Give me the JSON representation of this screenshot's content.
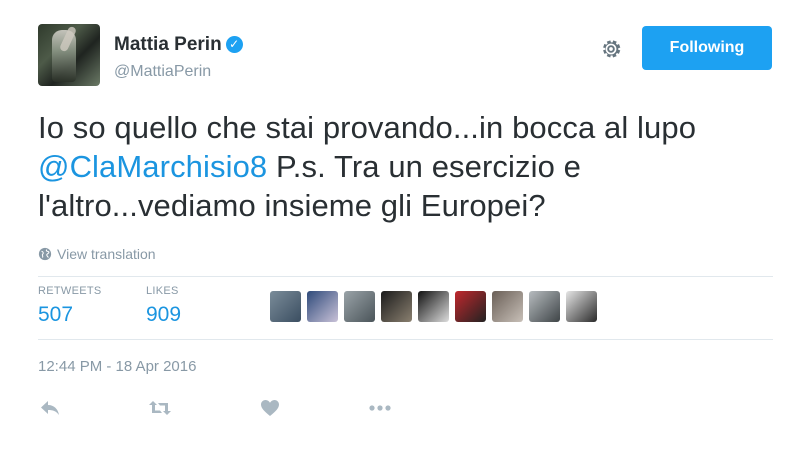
{
  "author": {
    "display_name": "Mattia Perin",
    "handle": "@MattiaPerin",
    "verified": true
  },
  "follow_button": {
    "label": "Following",
    "color": "#1da1f2"
  },
  "tweet": {
    "text_part1": "Io so quello che stai provando...in bocca al lupo ",
    "mention": "@ClaMarchisio8",
    "text_part2": " P.s. Tra un esercizio e l'altro...vediamo insieme gli Europei?",
    "mention_color": "#1b95e0"
  },
  "translation_link": "View translation",
  "stats": {
    "retweets_label": "RETWEETS",
    "retweets_value": "507",
    "likes_label": "LIKES",
    "likes_value": "909"
  },
  "liker_avatars": [
    {
      "name": "liker-avatar-1",
      "colors": [
        "#7a8c99",
        "#3b4e61"
      ]
    },
    {
      "name": "liker-avatar-2",
      "colors": [
        "#2e4a7a",
        "#c9c2d8"
      ]
    },
    {
      "name": "liker-avatar-3",
      "colors": [
        "#9aa3a8",
        "#4a5459"
      ]
    },
    {
      "name": "liker-avatar-4",
      "colors": [
        "#1b1b1b",
        "#8a8070"
      ]
    },
    {
      "name": "liker-avatar-5",
      "colors": [
        "#111111",
        "#dddddd"
      ]
    },
    {
      "name": "liker-avatar-6",
      "colors": [
        "#c0282d",
        "#222222"
      ]
    },
    {
      "name": "liker-avatar-7",
      "colors": [
        "#6a5f57",
        "#c8c0b8"
      ]
    },
    {
      "name": "liker-avatar-8",
      "colors": [
        "#b7bcbf",
        "#3e4447"
      ]
    },
    {
      "name": "liker-avatar-9",
      "colors": [
        "#e6e6e6",
        "#2a2a2a"
      ]
    }
  ],
  "timestamp": "12:44 PM - 18 Apr 2016",
  "actions": {
    "icons": [
      "reply-icon",
      "retweet-icon",
      "like-icon",
      "more-icon"
    ],
    "icon_color": "#aab8c2"
  }
}
